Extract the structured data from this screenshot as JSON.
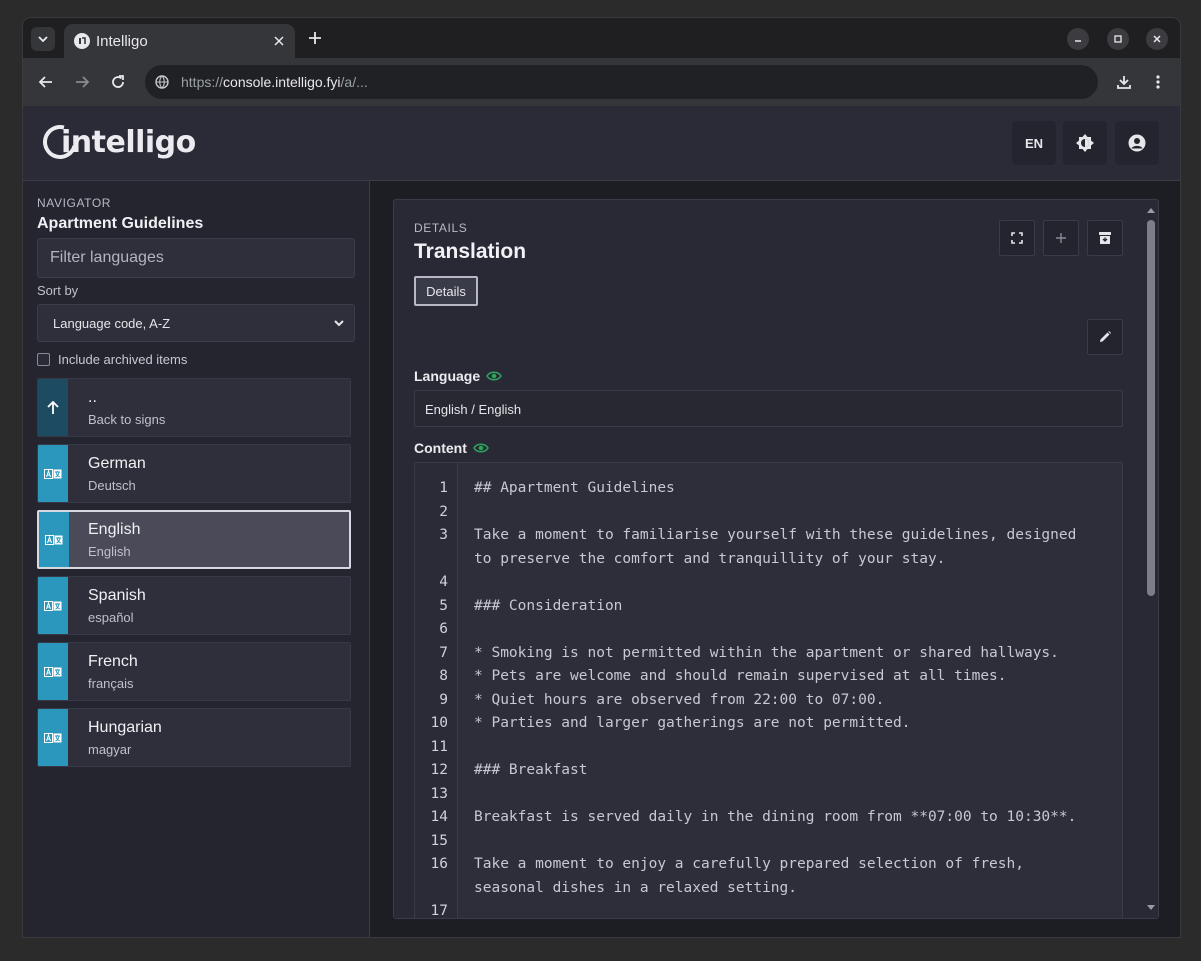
{
  "browser": {
    "tab_title": "Intelligo",
    "url_scheme": "https://",
    "url_host": "console.intelligo.fyi",
    "url_path": "/a/..."
  },
  "header": {
    "logo_text": "intelligo",
    "lang_button": "EN"
  },
  "sidebar": {
    "section_label": "NAVIGATOR",
    "title": "Apartment Guidelines",
    "filter_placeholder": "Filter languages",
    "sort_label": "Sort by",
    "sort_value": "Language code, A-Z",
    "archived_label": "Include archived items",
    "items": [
      {
        "name": "..",
        "native": "Back to signs"
      },
      {
        "name": "German",
        "native": "Deutsch"
      },
      {
        "name": "English",
        "native": "English"
      },
      {
        "name": "Spanish",
        "native": "español"
      },
      {
        "name": "French",
        "native": "français"
      },
      {
        "name": "Hungarian",
        "native": "magyar"
      }
    ]
  },
  "details": {
    "section_label": "DETAILS",
    "title": "Translation",
    "tab_label": "Details",
    "language_label": "Language",
    "language_value": "English / English",
    "content_label": "Content"
  },
  "editor": {
    "lines": [
      {
        "n": "1",
        "t": "## Apartment Guidelines"
      },
      {
        "n": "2",
        "t": ""
      },
      {
        "n": "3",
        "t": "Take a moment to familiarise yourself with these guidelines, designed"
      },
      {
        "n": "",
        "t": "to preserve the comfort and tranquillity of your stay."
      },
      {
        "n": "4",
        "t": ""
      },
      {
        "n": "5",
        "t": "### Consideration"
      },
      {
        "n": "6",
        "t": ""
      },
      {
        "n": "7",
        "t": "* Smoking is not permitted within the apartment or shared hallways."
      },
      {
        "n": "8",
        "t": "* Pets are welcome and should remain supervised at all times."
      },
      {
        "n": "9",
        "t": "* Quiet hours are observed from 22:00 to 07:00."
      },
      {
        "n": "10",
        "t": "* Parties and larger gatherings are not permitted."
      },
      {
        "n": "11",
        "t": ""
      },
      {
        "n": "12",
        "t": "### Breakfast"
      },
      {
        "n": "13",
        "t": ""
      },
      {
        "n": "14",
        "t": "Breakfast is served daily in the dining room from **07:00 to 10:30**."
      },
      {
        "n": "15",
        "t": ""
      },
      {
        "n": "16",
        "t": "Take a moment to enjoy a carefully prepared selection of fresh,"
      },
      {
        "n": "",
        "t": "seasonal dishes in a relaxed setting."
      },
      {
        "n": "17",
        "t": ""
      }
    ]
  },
  "colors": {
    "accent_badge": "#2b97bd",
    "back_badge": "#1d4c62",
    "visible_eye": "#2fa35b"
  }
}
